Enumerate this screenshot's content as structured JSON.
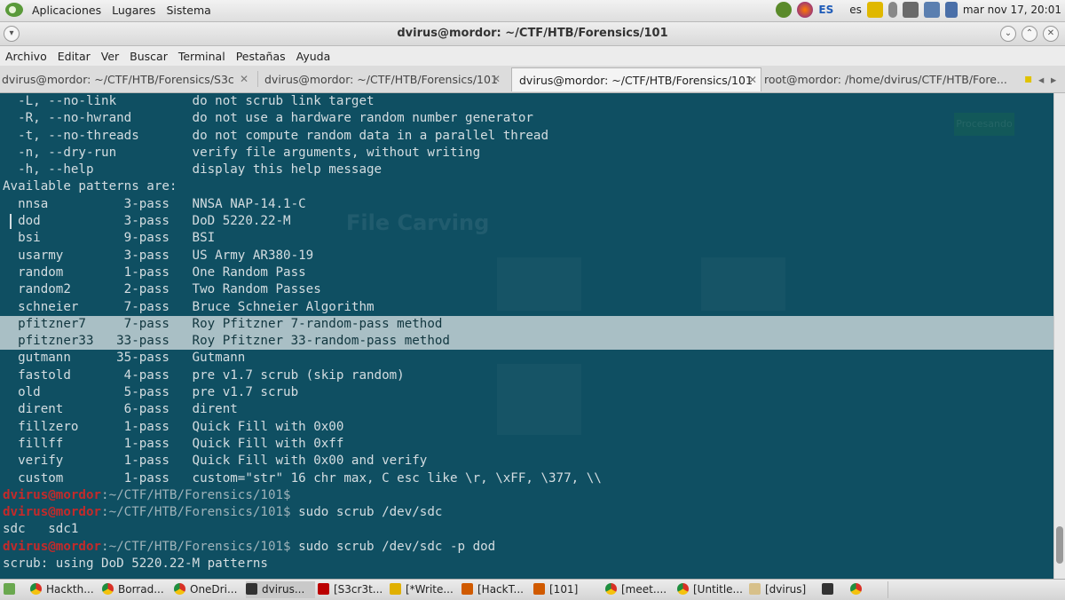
{
  "top_panel": {
    "menus": [
      "Aplicaciones",
      "Lugares",
      "Sistema"
    ],
    "keyboard_layout": "ES",
    "lang": "es",
    "clock": "mar nov 17, 20:01"
  },
  "window": {
    "title": "dvirus@mordor: ~/CTF/HTB/Forensics/101",
    "menu": [
      "Archivo",
      "Editar",
      "Ver",
      "Buscar",
      "Terminal",
      "Pestañas",
      "Ayuda"
    ],
    "tabs": [
      "dvirus@mordor: ~/CTF/HTB/Forensics/S3c",
      "dvirus@mordor: ~/CTF/HTB/Forensics/101",
      "dvirus@mordor: ~/CTF/HTB/Forensics/101",
      "root@mordor: /home/dvirus/CTF/HTB/Fore..."
    ]
  },
  "terminal": {
    "lines": [
      "  -L, --no-link          do not scrub link target",
      "  -R, --no-hwrand        do not use a hardware random number generator",
      "  -t, --no-threads       do not compute random data in a parallel thread",
      "  -n, --dry-run          verify file arguments, without writing",
      "  -h, --help             display this help message",
      "Available patterns are:",
      "  nnsa          3-pass   NNSA NAP-14.1-C",
      "  dod           3-pass   DoD 5220.22-M",
      "  bsi           9-pass   BSI",
      "  usarmy        3-pass   US Army AR380-19",
      "  random        1-pass   One Random Pass",
      "  random2       2-pass   Two Random Passes",
      "  schneier      7-pass   Bruce Schneier Algorithm",
      "  pfitzner7     7-pass   Roy Pfitzner 7-random-pass method",
      "  pfitzner33   33-pass   Roy Pfitzner 33-random-pass method",
      "  gutmann      35-pass   Gutmann",
      "  fastold       4-pass   pre v1.7 scrub (skip random)",
      "  old           5-pass   pre v1.7 scrub",
      "  dirent        6-pass   dirent",
      "  fillzero      1-pass   Quick Fill with 0x00",
      "  fillff        1-pass   Quick Fill with 0xff",
      "  verify        1-pass   Quick Fill with 0x00 and verify",
      "  custom        1-pass   custom=\"str\" 16 chr max, C esc like \\r, \\xFF, \\377, \\\\"
    ],
    "selected_lines": [
      13,
      14
    ],
    "prompt_user": "dvirus@mordor",
    "prompt_path": ":~/CTF/HTB/Forensics/101",
    "prompt_symbol": "$",
    "commands": [
      "",
      " sudo scrub /dev/sdc",
      " sudo scrub /dev/sdc -p dod"
    ],
    "completion_output": "sdc   sdc1",
    "scrub_output": "scrub: using DoD 5220.22-M patterns",
    "background_heading": "File Carving",
    "background_button": "Procesando"
  },
  "taskbar": {
    "items": [
      "Hackth...",
      "Borrad...",
      "OneDri...",
      "dvirus...",
      "[S3cr3t...",
      "[*Write...",
      "[HackT...",
      "[101]",
      "[meet....",
      "[Untitle...",
      "[dvirus]"
    ]
  },
  "colors": {
    "terminal_bg": "#0f4f62",
    "terminal_fg": "#d4dde1",
    "selection_bg": "#a9bfc5",
    "prompt_user": "#c42a2a"
  }
}
